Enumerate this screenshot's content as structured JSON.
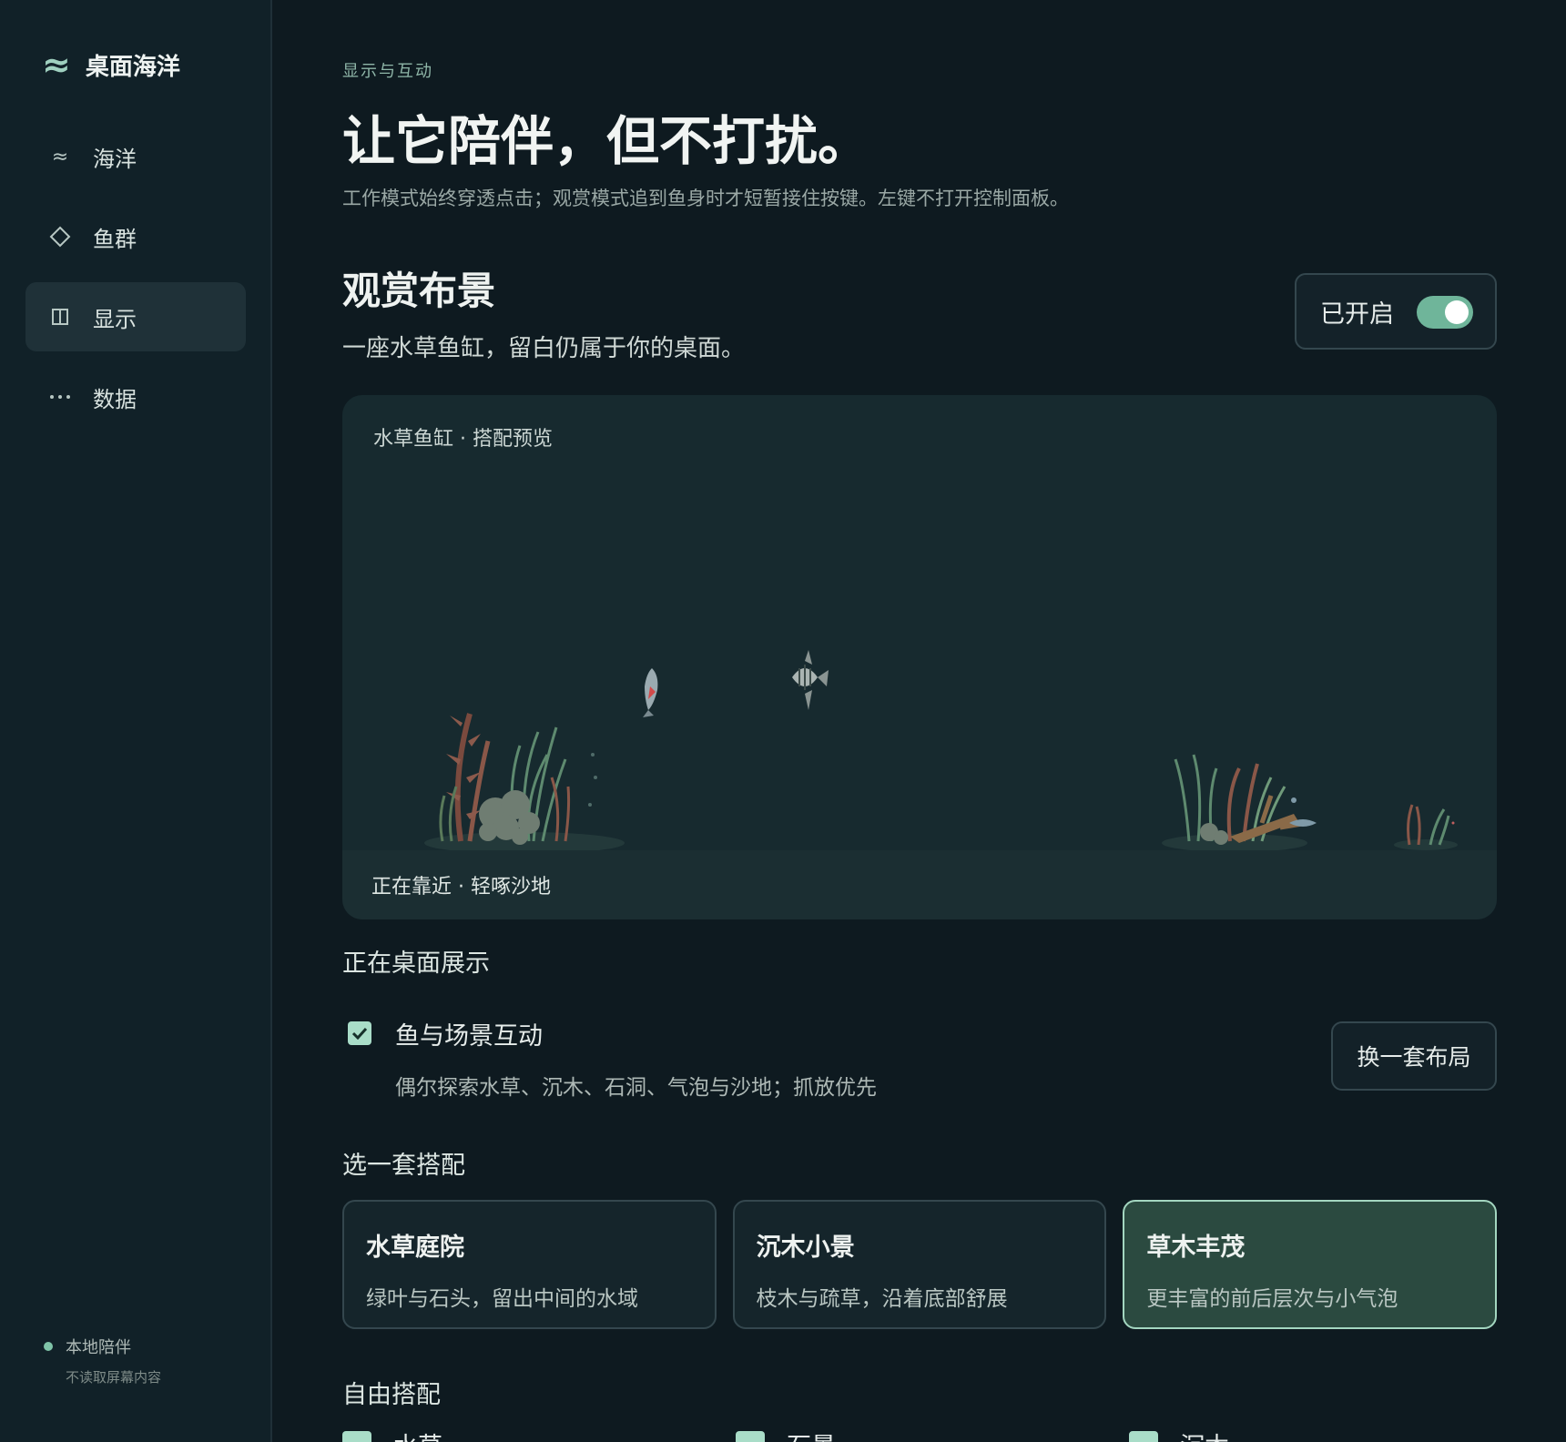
{
  "app": {
    "name": "桌面海洋",
    "logo_icon": "wave-icon"
  },
  "sidebar": {
    "items": [
      {
        "label": "海洋",
        "icon": "wave-icon",
        "active": false
      },
      {
        "label": "鱼群",
        "icon": "diamond-icon",
        "active": false
      },
      {
        "label": "显示",
        "icon": "panel-icon",
        "active": true
      },
      {
        "label": "数据",
        "icon": "more-icon",
        "active": false
      }
    ],
    "footer": {
      "title": "本地陪伴",
      "subtitle": "不读取屏幕内容",
      "status_color": "#7fc4a8"
    }
  },
  "page": {
    "eyebrow": "显示与互动",
    "title": "让它陪伴，但不打扰。",
    "subtitle": "工作模式始终穿透点击；观赏模式追到鱼身时才短暂接住按键。左键不打开控制面板。"
  },
  "section": {
    "title": "观赏布景",
    "description": "一座水草鱼缸，留白仍属于你的桌面。",
    "toggle": {
      "label": "已开启",
      "on": true
    }
  },
  "preview": {
    "title": "水草鱼缸 · 搭配预览",
    "status": "正在靠近 · 轻啄沙地"
  },
  "display": {
    "heading": "正在桌面展示",
    "interaction": {
      "checked": true,
      "title": "鱼与场景互动",
      "description": "偶尔探索水草、沉木、石洞、气泡与沙地；抓放优先"
    },
    "shuffle_button": "换一套布局"
  },
  "presets": {
    "heading": "选一套搭配",
    "items": [
      {
        "name": "水草庭院",
        "description": "绿叶与石头，留出中间的水域",
        "selected": false
      },
      {
        "name": "沉木小景",
        "description": "枝木与疏草，沿着底部舒展",
        "selected": false
      },
      {
        "name": "草木丰茂",
        "description": "更丰富的前后层次与小气泡",
        "selected": true
      }
    ]
  },
  "free": {
    "heading": "自由搭配",
    "items": [
      {
        "label": "水草",
        "checked": true
      },
      {
        "label": "石景",
        "checked": true
      },
      {
        "label": "沉木",
        "checked": true
      }
    ]
  },
  "colors": {
    "accent": "#6fb59a",
    "background": "#0e1a20",
    "selected_card": "#2b4a40"
  }
}
